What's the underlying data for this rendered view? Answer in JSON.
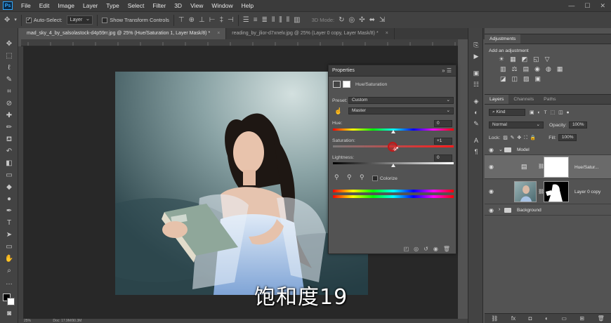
{
  "menubar": {
    "logo": "Ps",
    "items": [
      "File",
      "Edit",
      "Image",
      "Layer",
      "Type",
      "Select",
      "Filter",
      "3D",
      "View",
      "Window",
      "Help"
    ],
    "window_controls": [
      "—",
      "☐",
      "✕"
    ]
  },
  "options": {
    "auto_select_label": "Auto-Select:",
    "auto_select_value": "Layer",
    "show_transform_label": "Show Transform Controls",
    "mode_label": "3D Mode:"
  },
  "tabs": [
    {
      "label": "mad_sky_4_by_salsolastock-d4p59rr.jpg @ 25% (Hue/Saturation 1, Layer Mask/8) *",
      "close": "×"
    },
    {
      "label": "reading_by_jlior-d7xnelv.jpg @ 25% (Layer 0 copy, Layer Mask/8) *",
      "close": "×"
    }
  ],
  "subtitle": "饱和度19",
  "properties": {
    "title": "Properties",
    "adjustment_name": "Hue/Saturation",
    "preset_label": "Preset:",
    "preset_value": "Custom",
    "channel_value": "Master",
    "hue_label": "Hue:",
    "hue_value": "0",
    "saturation_label": "Saturation:",
    "saturation_value": "+1",
    "lightness_label": "Lightness:",
    "lightness_value": "0",
    "colorize_label": "Colorize"
  },
  "adjustments": {
    "tab": "Adjustments",
    "subtitle": "Add an adjustment",
    "row1_icons": [
      "☀",
      "▦",
      "◩",
      "◱",
      "▽"
    ],
    "row2_icons": [
      "▥",
      "⚖",
      "▤",
      "◉",
      "◍",
      "▦"
    ],
    "row3_icons": [
      "◪",
      "◫",
      "▨",
      "▣"
    ]
  },
  "layers": {
    "tabs": [
      "Layers",
      "Channels",
      "Paths"
    ],
    "kind_label": "Kind",
    "blend_mode": "Normal",
    "opacity_label": "Opacity:",
    "opacity_value": "100%",
    "lock_label": "Lock:",
    "fill_label": "Fill:",
    "fill_value": "100%",
    "items": [
      {
        "name": "Model",
        "type": "group"
      },
      {
        "name": "Hue/Satur...",
        "type": "adjustment"
      },
      {
        "name": "Layer 0 copy",
        "type": "pixel"
      },
      {
        "name": "Background",
        "type": "group"
      }
    ]
  },
  "status": {
    "zoom": "25%",
    "doc": "Doc: 17.9M/90.3M"
  }
}
